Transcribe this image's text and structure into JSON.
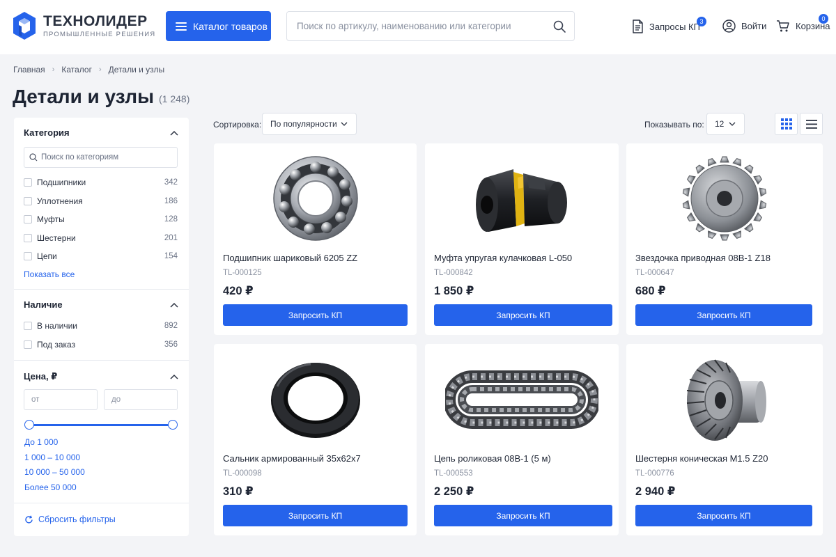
{
  "header": {
    "logo_name": "ТЕХНОЛИДЕР",
    "logo_sub": "ПРОМЫШЛЕННЫЕ РЕШЕНИЯ",
    "catalog_label": "Каталог товаров",
    "search_placeholder": "Поиск по артикулу, наименованию или категории",
    "quotes_label": "Запросы КП",
    "quotes_count": "3",
    "login_label": "Войти",
    "cart_label": "Корзина",
    "cart_count": "0",
    "accent": "#2563eb"
  },
  "breadcrumb": [
    "Главная",
    "Каталог",
    "Детали и узлы"
  ],
  "page": {
    "title": "Детали и узлы",
    "count": "(1 248)"
  },
  "filters": {
    "category": {
      "title": "Категория",
      "search_placeholder": "Поиск по категориям",
      "items": [
        {
          "label": "Подшипники",
          "count": "342"
        },
        {
          "label": "Уплотнения",
          "count": "186"
        },
        {
          "label": "Муфты",
          "count": "128"
        },
        {
          "label": "Шестерни",
          "count": "201"
        },
        {
          "label": "Цепи",
          "count": "154"
        }
      ],
      "show_all": "Показать все"
    },
    "availability": {
      "title": "Наличие",
      "items": [
        {
          "label": "В наличии",
          "count": "892"
        },
        {
          "label": "Под заказ",
          "count": "356"
        }
      ]
    },
    "price": {
      "title": "Цена, ₽",
      "from_placeholder": "от",
      "to_placeholder": "до",
      "ranges": [
        "До 1 000",
        "1 000 – 10 000",
        "10 000 – 50 000",
        "Более 50 000"
      ]
    },
    "reset_label": "Сбросить фильтры"
  },
  "toolbar": {
    "sort_label": "Сортировка:",
    "sort_value": "По популярности",
    "per_page_label": "Показывать по:",
    "per_page_value": "12"
  },
  "products": [
    {
      "name": "Подшипник шариковый 6205 ZZ",
      "sku": "TL-000125",
      "price": "420 ₽",
      "button": "Запросить КП",
      "image": "bearing-image"
    },
    {
      "name": "Муфта упругая кулачковая L-050",
      "sku": "TL-000842",
      "price": "1 850 ₽",
      "button": "Запросить КП",
      "image": "coupling-image"
    },
    {
      "name": "Звездочка приводная 08B-1 Z18",
      "sku": "TL-000647",
      "price": "680 ₽",
      "button": "Запросить КП",
      "image": "sprocket-image"
    },
    {
      "name": "Сальник армированный 35x62x7",
      "sku": "TL-000098",
      "price": "310 ₽",
      "button": "Запросить КП",
      "image": "oil-seal-image"
    },
    {
      "name": "Цепь роликовая 08B-1 (5 м)",
      "sku": "TL-000553",
      "price": "2 250 ₽",
      "button": "Запросить КП",
      "image": "roller-chain-image"
    },
    {
      "name": "Шестерня коническая M1.5 Z20",
      "sku": "TL-000776",
      "price": "2 940 ₽",
      "button": "Запросить КП",
      "image": "bevel-gear-image"
    }
  ]
}
